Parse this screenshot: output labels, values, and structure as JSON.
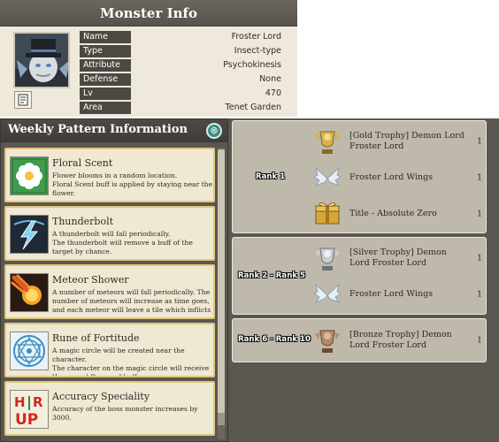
{
  "monster_info": {
    "title": "Monster Info",
    "fields": [
      {
        "label": "Name",
        "value": "Froster Lord"
      },
      {
        "label": "Type",
        "value": "Insect-type"
      },
      {
        "label": "Attribute",
        "value": "Psychokinesis"
      },
      {
        "label": "Defense type",
        "value": "None"
      },
      {
        "label": "Lv",
        "value": "470"
      },
      {
        "label": "Area",
        "value": "Tenet Garden"
      }
    ]
  },
  "weekly": {
    "title": "Weekly Pattern Information",
    "close_icon": "⊗",
    "patterns": [
      {
        "name": "Floral Scent",
        "icon": "flower-icon",
        "desc": "Flower blooms in a random location.\nFloral Scent buff is applied by staying near the flower."
      },
      {
        "name": "Thunderbolt",
        "icon": "lightning-icon",
        "desc": "A thunderbolt will fall periodically.\nThe thunderbolt will remove a buff of the target by chance."
      },
      {
        "name": "Meteor Shower",
        "icon": "meteor-icon",
        "desc": "A number of meteors will fall periodically. The number of meteors will increase as time goes, and each meteor will leave a tile which inflicts"
      },
      {
        "name": "Rune of Fortitude",
        "icon": "rune-icon",
        "desc": "A magic circle will be created near the character.\nThe character on the magic circle will receive [Increased Damage] buff."
      },
      {
        "name": "Accuracy Speciality",
        "icon": "hr-up-icon",
        "icon_text": [
          "H",
          "R",
          "UP"
        ],
        "desc": "Accuracy of the boss monster increases by 3000."
      }
    ]
  },
  "rewards": [
    {
      "rank": "Rank 1",
      "items": [
        {
          "name": "[Gold Trophy] Demon Lord Froster Lord",
          "count": "1",
          "icon": "gold-trophy-icon"
        },
        {
          "name": "Froster Lord Wings",
          "count": "1",
          "icon": "wings-icon"
        },
        {
          "name": "Title - Absolute Zero",
          "count": "1",
          "icon": "gold-box-icon"
        }
      ]
    },
    {
      "rank": "Rank 2 - Rank 5",
      "items": [
        {
          "name": "[Silver Trophy] Demon Lord Froster Lord",
          "count": "1",
          "icon": "silver-trophy-icon"
        },
        {
          "name": "Froster Lord Wings",
          "count": "1",
          "icon": "wings-icon"
        }
      ]
    },
    {
      "rank": "Rank 6 - Rank 10",
      "items": [
        {
          "name": "[Bronze Trophy] Demon Lord Froster Lord",
          "count": "1",
          "icon": "bronze-trophy-icon"
        }
      ]
    }
  ]
}
